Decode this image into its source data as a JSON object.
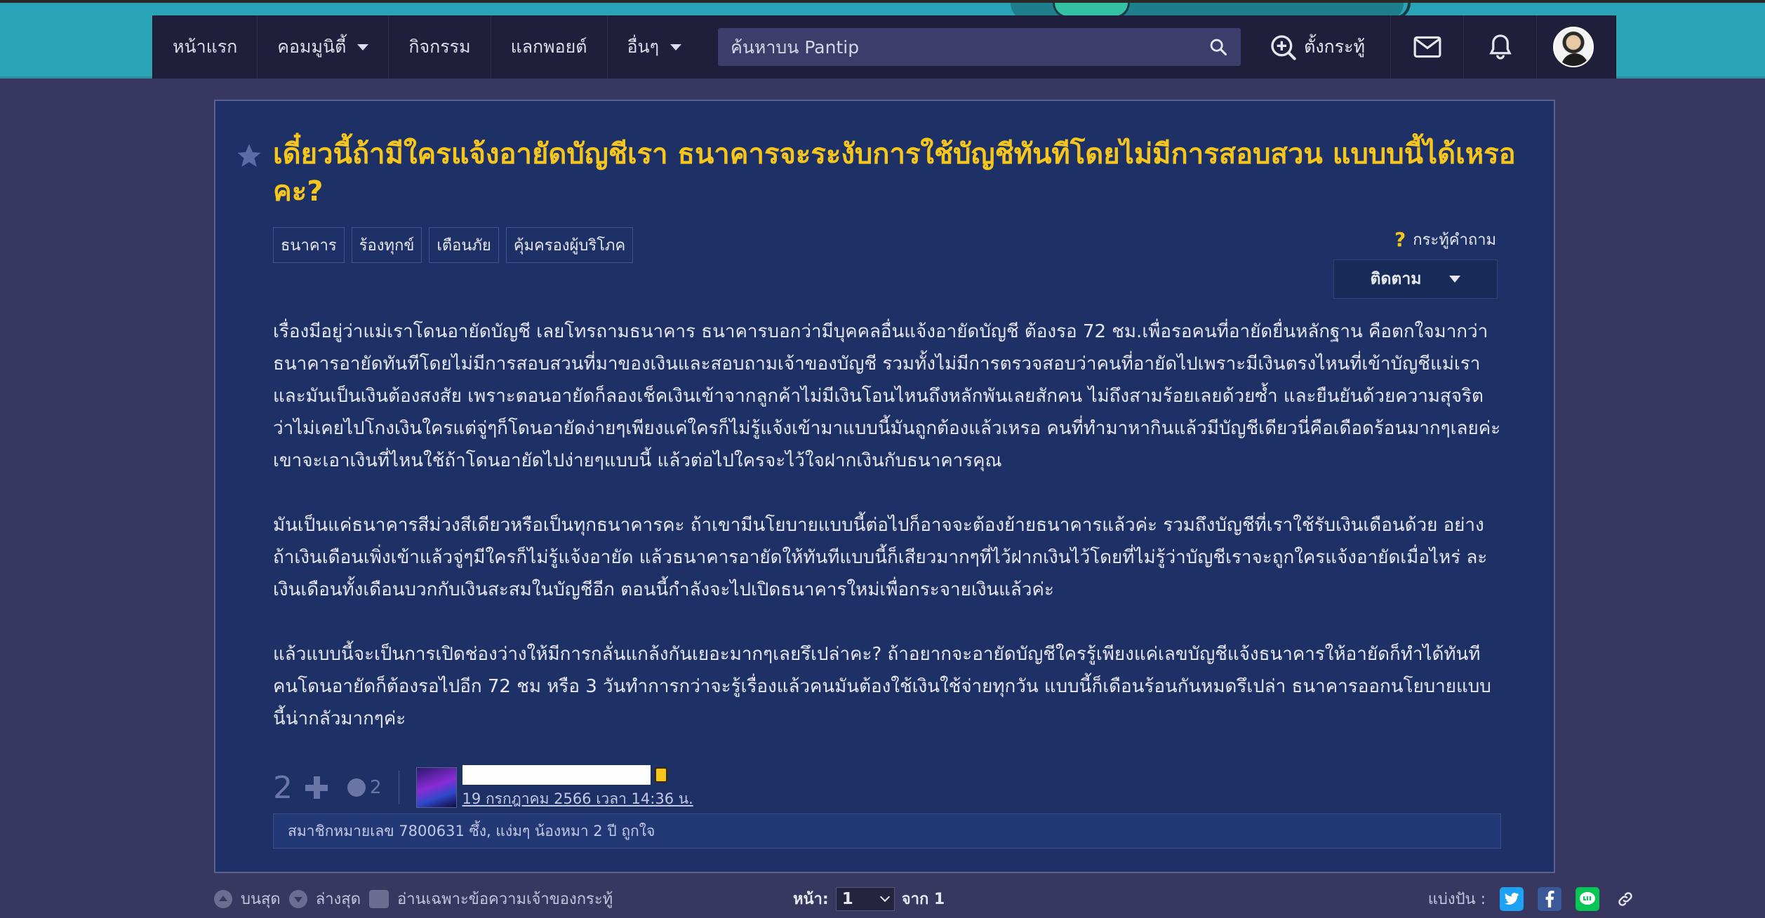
{
  "nav": {
    "home": "หน้าแรก",
    "community": "คอมมูนิตี้",
    "activities": "กิจกรรม",
    "points": "แลกพอยต์",
    "more": "อื่นๆ",
    "search_placeholder": "ค้นหาบน Pantip",
    "new_topic": "ตั้งกระทู้"
  },
  "post": {
    "title": "เดี๋ยวนี้ถ้ามีใครแจ้งอายัดบัญชีเรา ธนาคารจะระงับการใช้บัญชีทันทีโดยไม่มีการสอบสวน แบบบนี้ได้เหรอคะ?",
    "tags": [
      "ธนาคาร",
      "ร้องทุกข์",
      "เตือนภัย",
      "คุ้มครองผู้บริโภค"
    ],
    "question_type": "กระทู้คำถาม",
    "follow_label": "ติดตาม",
    "paragraphs": [
      "เรื่องมีอยู่ว่าแม่เราโดนอายัดบัญชี เลยโทรถามธนาคาร ธนาคารบอกว่ามีบุคคลอื่นแจ้งอายัดบัญชี ต้องรอ 72 ชม.เพื่อรอคนที่อายัดยื่นหลักฐาน คือตกใจมากว่าธนาคารอายัดทันทีโดยไม่มีการสอบสวนที่มาของเงินและสอบถามเจ้าของบัญชี รวมทั้งไม่มีการตรวจสอบว่าคนที่อายัดไปเพราะมีเงินตรงไหนที่เข้าบัญชีแม่เราและมันเป็นเงินต้องสงสัย เพราะตอนอายัดก็ลองเช็คเงินเข้าจากลูกค้าไม่มีเงินโอนไหนถึงหลักพันเลยสักคน ไม่ถึงสามร้อยเลยด้วยซ้ำ และยืนยันด้วยความสุจริตว่าไม่เคยไปโกงเงินใครแต่จู่ๆก็โดนอายัดง่ายๆเพียงแค่ใครก็ไม่รู้แจ้งเข้ามาแบบนี้มันถูกต้องแล้วเหรอ คนที่ทำมาหากินแล้วมีบัญชีเดียวนี่คือเดือดร้อนมากๆเลยค่ะ เขาจะเอาเงินที่ไหนใช้ถ้าโดนอายัดไปง่ายๆแบบนี้ แล้วต่อไปใครจะไว้ใจฝากเงินกับธนาคารคุณ",
      "มันเป็นแค่ธนาคารสีม่วงสีเดียวหรือเป็นทุกธนาคารคะ ถ้าเขามีนโยบายแบบนี้ต่อไปก็อาจจะต้องย้ายธนาคารแล้วค่ะ รวมถึงบัญชีที่เราใช้รับเงินเดือนด้วย อย่างถ้าเงินเดือนเพิ่งเข้าแล้วจู่ๆมีใครก็ไม่รู้แจ้งอายัด แล้วธนาคารอายัดให้ทันทีแบบนี้ก็เสียวมากๆที่ไว้ฝากเงินไว้โดยที่ไม่รู้ว่าบัญชีเราจะถูกใครแจ้งอายัดเมื่อไหร่ ละเงินเดือนทั้งเดือนบวกกับเงินสะสมในบัญชีอีก ตอนนี้กำลังจะไปเปิดธนาคารใหม่เพื่อกระจายเงินแล้วค่ะ",
      "แล้วแบบนี้จะเป็นการเปิดช่องว่างให้มีการกลั่นแกล้งกันเยอะมากๆเลยรึเปล่าคะ? ถ้าอยากจะอายัดบัญชีใครรู้เพียงแค่เลขบัญชีแจ้งธนาคารให้อายัดก็ทำได้ทันที คนโดนอายัดก็ต้องรอไปอีก 72 ชม หรือ 3 วันทำการกว่าจะรู้เรื่องแล้วคนมันต้องใช้เงินใช้จ่ายทุกวัน แบบนี้ก็เดือนร้อนกันหมดรึเปล่า ธนาคารออกนโยบายแบบนี้น่ากลัวมากๆค่ะ"
    ],
    "vote_count": "2",
    "emotion_count": "2",
    "date": "19 กรกฎาคม 2566 เวลา 14:36 น.",
    "reactions": "สมาชิกหมายเลข 7800631 ซึ้ง, แง่มๆ น้องหมา 2 ปี ถูกใจ"
  },
  "bottom": {
    "top": "บนสุด",
    "bottom": "ล่างสุด",
    "owner_only": "อ่านเฉพาะข้อความเจ้าของกระทู้",
    "page_label": "หน้า:",
    "page_value": "1",
    "page_of": "จาก 1",
    "share_label": "แบ่งปัน :"
  },
  "colors": {
    "title": "#f6c61c",
    "card": "#1e3166",
    "navbar": "#1f1f3c",
    "banner": "#2aa3b6"
  }
}
